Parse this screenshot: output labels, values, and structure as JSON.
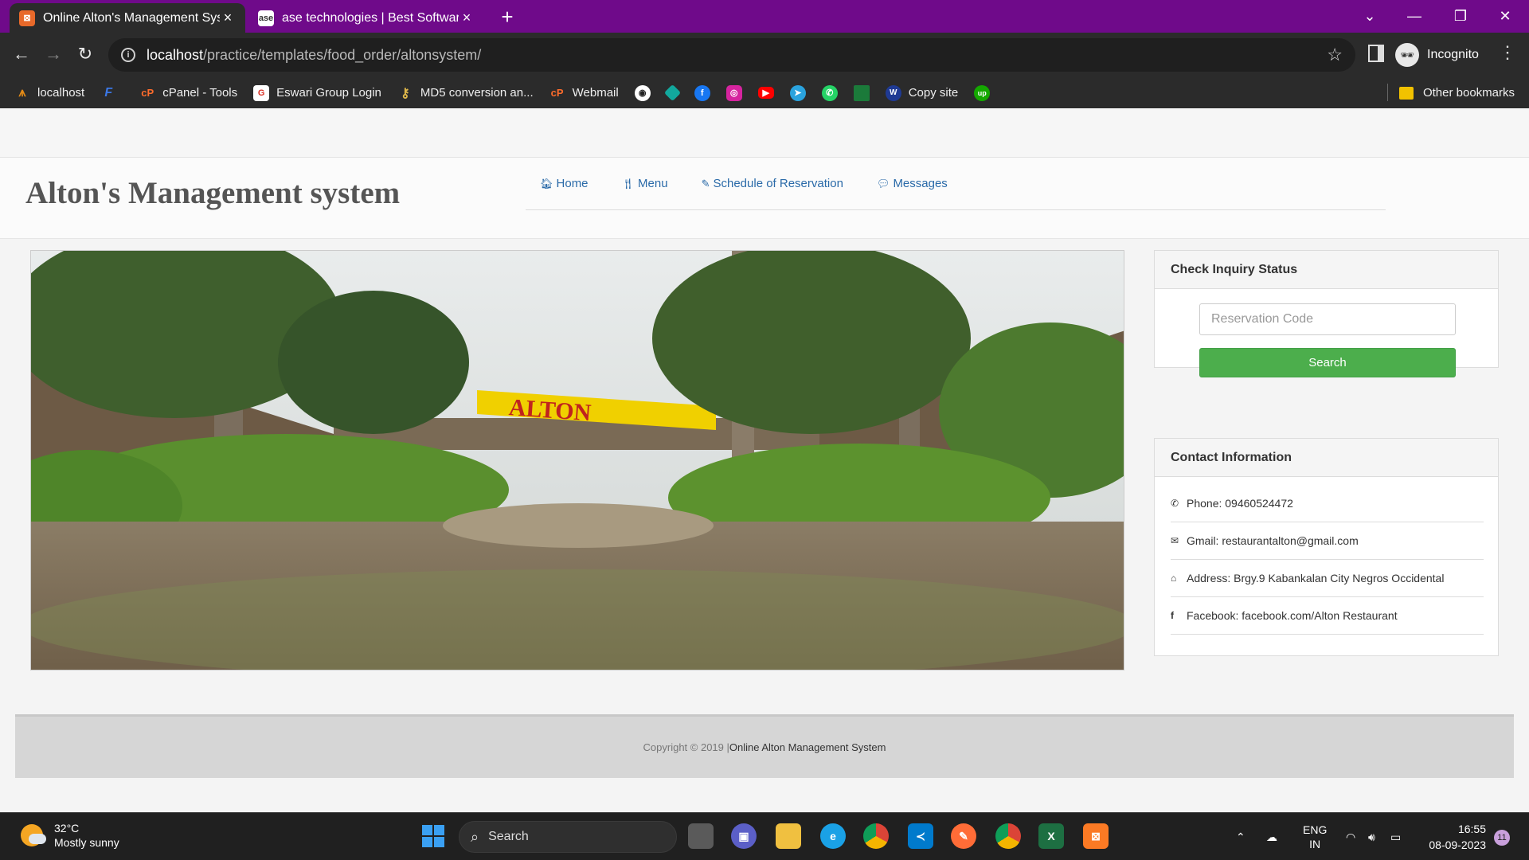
{
  "browser": {
    "tabs": [
      {
        "title": "Online Alton's Management Syst",
        "active": true
      },
      {
        "title": "ase technologies | Best Software",
        "active": false
      }
    ],
    "new_tab": "+",
    "window_controls": {
      "tab_search": "⌄",
      "minimize": "—",
      "restore": "❐",
      "close": "✕"
    },
    "address": {
      "host": "localhost",
      "path": "/practice/templates/food_order/altonsystem/"
    },
    "profile_label": "Incognito",
    "bookmarks": [
      {
        "label": "localhost",
        "color": "#e58b16"
      },
      {
        "label": "",
        "color": "#3b78e7"
      },
      {
        "label": "cPanel - Tools",
        "color": "#ff6c2c"
      },
      {
        "label": "Eswari Group Login",
        "color": "#d93025"
      },
      {
        "label": "MD5 conversion an...",
        "color": "#e0b84a"
      },
      {
        "label": "Webmail",
        "color": "#ff6c2c"
      }
    ],
    "bookmark_icons": [
      "github-icon",
      "diamond-icon",
      "facebook-icon",
      "instagram-icon",
      "youtube-icon",
      "telegram-icon",
      "whatsapp-icon",
      "sheet-icon"
    ],
    "copy_site_label": "Copy site",
    "other_bookmarks_label": "Other bookmarks"
  },
  "site": {
    "brand": "Alton's Management system",
    "nav": [
      {
        "label": "Home",
        "icon": "home-icon",
        "glyph": "🏠︎"
      },
      {
        "label": "Menu",
        "icon": "cutlery-icon",
        "glyph": "🍴︎"
      },
      {
        "label": "Schedule of Reservation",
        "icon": "pencil-icon",
        "glyph": "✎"
      },
      {
        "label": "Messages",
        "icon": "comment-icon",
        "glyph": "💬︎"
      }
    ],
    "hero_sign": "ALTON"
  },
  "inquiry": {
    "title": "Check Inquiry Status",
    "placeholder": "Reservation Code",
    "button": "Search"
  },
  "contact": {
    "title": "Contact Information",
    "rows": [
      {
        "label": "Phone: 09460524472",
        "icon": "phone-icon",
        "glyph": "✆"
      },
      {
        "label": "Gmail: restaurantalton@gmail.com",
        "icon": "envelope-icon",
        "glyph": "✉"
      },
      {
        "label": "Address: Brgy.9 Kabankalan City Negros Occidental",
        "icon": "home-icon",
        "glyph": "⌂"
      },
      {
        "label": "Facebook: facebook.com/Alton Restaurant",
        "icon": "facebook-icon",
        "glyph": "f"
      }
    ]
  },
  "footer": {
    "copyright": "Copyright © 2019 | ",
    "link": "Online Alton Management System"
  },
  "taskbar": {
    "weather": {
      "temp": "32°C",
      "desc": "Mostly sunny"
    },
    "search": "Search",
    "lang": {
      "line1": "ENG",
      "line2": "IN"
    },
    "time": "16:55",
    "date": "08-09-2023",
    "notifications": "11"
  }
}
